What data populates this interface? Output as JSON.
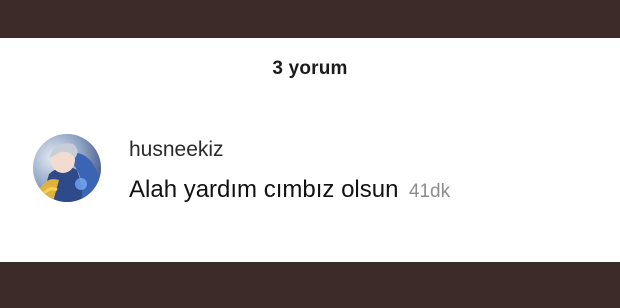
{
  "header": {
    "comment_count": "3 yorum"
  },
  "comments": [
    {
      "username": "husneekiz",
      "text": "Alah yardım cımbız olsun",
      "timestamp": "41dk",
      "avatar_icon": "user-avatar-icon"
    }
  ],
  "colors": {
    "frame": "#3c2b28",
    "panel": "#ffffff",
    "text": "#111111",
    "timestamp": "#8d8d8d"
  }
}
